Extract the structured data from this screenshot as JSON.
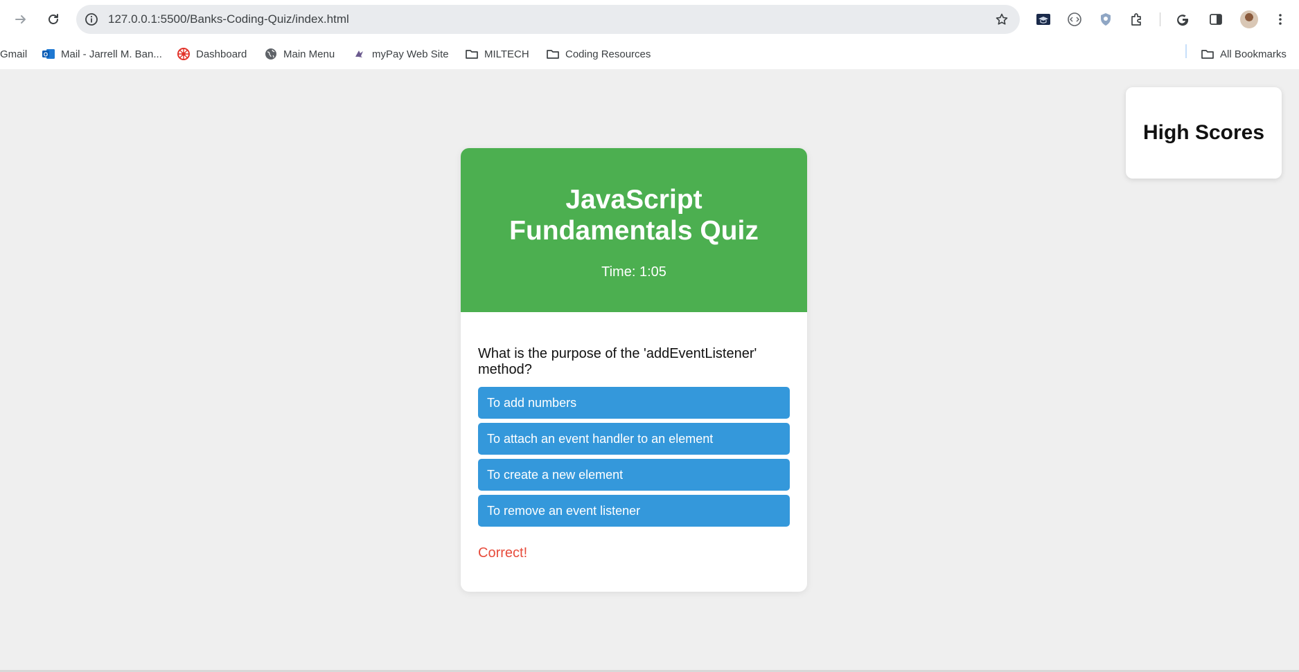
{
  "browser": {
    "url": "127.0.0.1:5500/Banks-Coding-Quiz/index.html",
    "icons": {
      "back": "arrow-right-icon",
      "reload": "reload-icon",
      "info": "info-icon",
      "star": "star-icon",
      "menu": "kebab-menu-icon"
    },
    "bookmarks": [
      {
        "label": "Gmail",
        "icon": "none"
      },
      {
        "label": "Mail - Jarrell M. Ban...",
        "icon": "outlook-icon"
      },
      {
        "label": "Dashboard",
        "icon": "dashboard-icon"
      },
      {
        "label": "Main Menu",
        "icon": "globe-icon"
      },
      {
        "label": "myPay Web Site",
        "icon": "eagle-icon"
      },
      {
        "label": "MILTECH",
        "icon": "folder-icon"
      },
      {
        "label": "Coding Resources",
        "icon": "folder-icon"
      }
    ],
    "all_bookmarks_label": "All Bookmarks"
  },
  "page": {
    "high_scores_label": "High Scores",
    "quiz": {
      "title": "JavaScript Fundamentals Quiz",
      "timer": "Time: 1:05",
      "question": "What is the purpose of the 'addEventListener' method?",
      "answers": [
        "To add numbers",
        "To attach an event handler to an element",
        "To create a new element",
        "To remove an event listener"
      ],
      "feedback": "Correct!"
    }
  },
  "colors": {
    "header_green": "#4caf50",
    "answer_blue": "#3498db",
    "feedback_red": "#e74c3c",
    "page_bg": "#efefef"
  }
}
